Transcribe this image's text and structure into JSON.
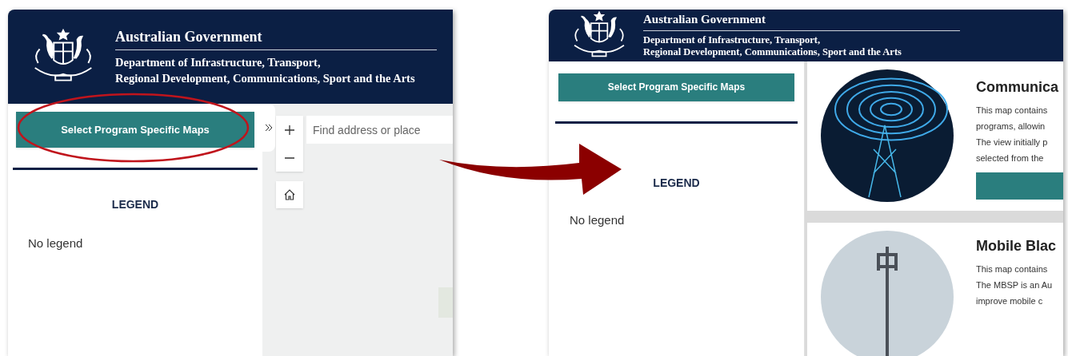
{
  "before": {
    "header": {
      "title": "Australian Government",
      "department": [
        "Department of Infrastructure, Transport,",
        "Regional Development, Communications, Sport and the Arts"
      ]
    },
    "sidebar": {
      "button": "Select Program Specific Maps",
      "legend_heading": "LEGEND",
      "legend_empty": "No legend"
    },
    "map": {
      "search": {
        "placeholder": "Find address or place"
      }
    }
  },
  "after": {
    "header": {
      "title": "Australian Government",
      "department": [
        "Department of Infrastructure, Transport,",
        "Regional Development, Communications, Sport and the Arts"
      ]
    },
    "sidebar": {
      "button": "Select Program Specific Maps",
      "legend_heading": "LEGEND",
      "legend_empty": "No legend"
    },
    "cards": [
      {
        "kind": "rings",
        "title": "Communica",
        "lines": [
          "This map contains",
          "programs, allowin",
          "The view initially p",
          "selected from the"
        ],
        "has_button": true
      },
      {
        "kind": "tower",
        "title": "Mobile Blac",
        "lines": [
          "This map contains",
          "The MBSP is an Au",
          "improve mobile c"
        ],
        "has_button": false
      }
    ]
  }
}
